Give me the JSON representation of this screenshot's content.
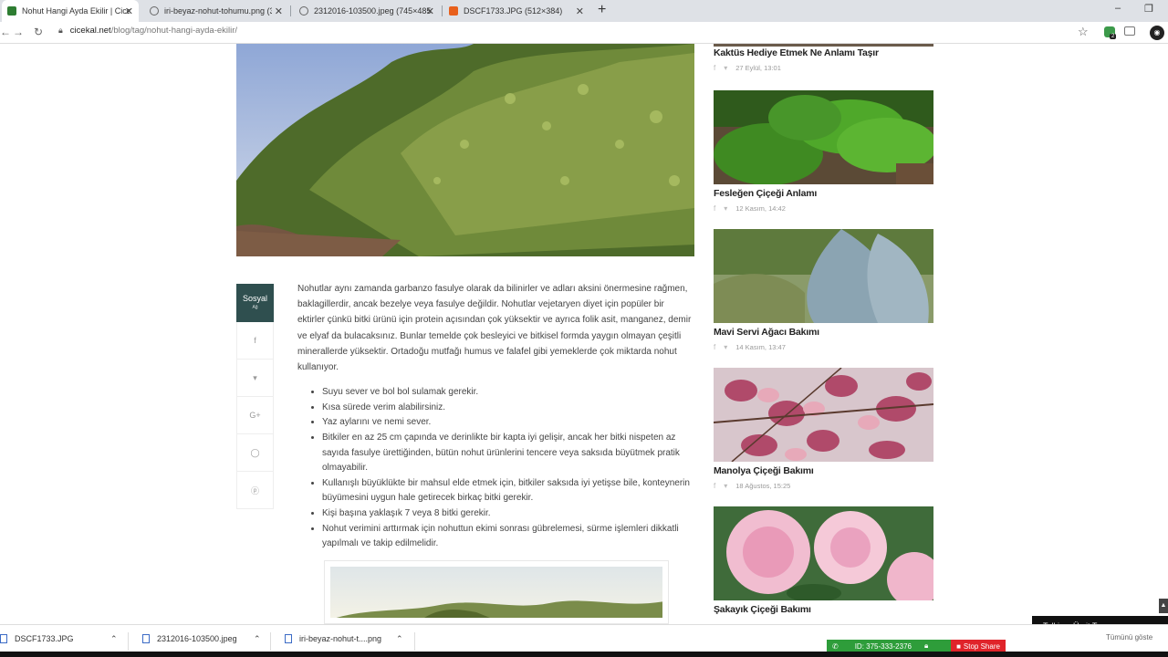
{
  "browser": {
    "tabs": [
      {
        "title": "Nohut Hangi Ayda Ekilir | Cicekal",
        "active": true
      },
      {
        "title": "iri-beyaz-nohut-tohumu.png (30",
        "active": false
      },
      {
        "title": "2312016-103500.jpeg (745×485)",
        "active": false
      },
      {
        "title": "DSCF1733.JPG (512×384)",
        "active": false
      }
    ],
    "url_domain": "cicekal.net",
    "url_path": "/blog/tag/nohut-hangi-ayda-ekilir/",
    "extension_badge": "2"
  },
  "share": {
    "title": "Sosyal",
    "subtitle": "Ağ"
  },
  "article": {
    "paragraph": "Nohutlar aynı zamanda garbanzo fasulye olarak da bilinirler ve adları aksini önermesine rağmen, baklagillerdir, ancak bezelye veya fasulye değildir. Nohutlar vejetaryen diyet için popüler bir ektirler çünkü bitki ürünü için protein açısından çok yüksektir ve ayrıca folik asit, manganez, demir ve elyaf da bulacaksınız. Bunlar temelde çok besleyici ve bitkisel formda yaygın olmayan çeşitli minerallerde yüksektir. Ortadoğu mutfağı humus ve falafel gibi yemeklerde çok miktarda nohut kullanıyor.",
    "bullets": [
      "Suyu sever ve bol bol sulamak gerekir.",
      "Kısa sürede verim alabilirsiniz.",
      "Yaz aylarını ve nemi sever.",
      "Bitkiler en az 25 cm çapında ve derinlikte bir kapta iyi gelişir, ancak her bitki nispeten az sayıda fasulye ürettiğinden, bütün nohut ürünlerini tencere veya saksıda büyütmek pratik olmayabilir.",
      "Kullanışlı büyüklükte bir mahsul elde etmek için, bitkiler saksıda iyi yetişse bile, konteynerin büyümesini uygun hale getirecek birkaç bitki gerekir.",
      "Kişi başına yaklaşık 7 veya 8 bitki gerekir.",
      "Nohut verimini arttırmak için nohuttun ekimi sonrası gübrelemesi, sürme işlemleri dikkatli yapılmalı ve takip edilmelidir."
    ]
  },
  "sidebar": {
    "posts": [
      {
        "title": "Kaktüs Hediye Etmek Ne Anlamı Taşır",
        "date": "27 Eylül, 13:01"
      },
      {
        "title": "Fesleğen Çiçeği Anlamı",
        "date": "12 Kasım, 14:42"
      },
      {
        "title": "Mavi Servi Ağacı Bakımı",
        "date": "14 Kasım, 13:47"
      },
      {
        "title": "Manolya Çiçeği Bakımı",
        "date": "18 Ağustos, 15:25"
      },
      {
        "title": "Şakayık Çiçeği Bakımı",
        "date": ""
      }
    ]
  },
  "downloads": [
    {
      "name": "DSCF1733.JPG"
    },
    {
      "name": "2312016-103500.jpeg"
    },
    {
      "name": "iri-beyaz-nohut-t....png"
    }
  ],
  "overlay": {
    "talking": "Talking: Ümit Tunç",
    "id_label": "ID: 375-333-2376",
    "stop_share": "Stop Share",
    "partial": "Tümünü göste"
  }
}
